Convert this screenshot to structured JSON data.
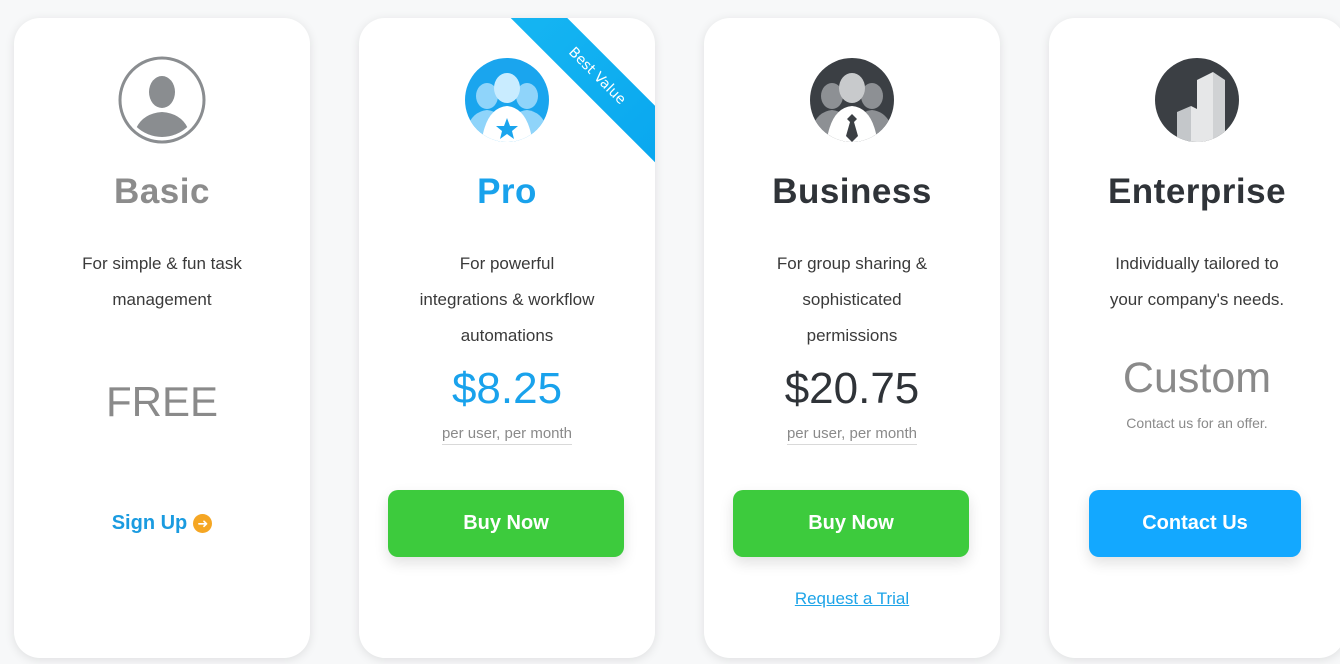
{
  "colors": {
    "basic_name": "#8c8c8c",
    "pro_accent": "#19a2ec",
    "business_name": "#2f3338",
    "enterprise_name": "#2f3338",
    "buy_green": "#3dcb3d",
    "contact_blue": "#13a8ff",
    "ribbon_blue": "#10aef0",
    "signup_arrow": "#f5a623"
  },
  "plans": {
    "basic": {
      "icon": "single-person-icon",
      "name": "Basic",
      "desc_line1": "For simple & fun task",
      "desc_line2": "management",
      "price": "FREE",
      "cta": "Sign Up",
      "cta_icon": "arrow-right-circle-icon"
    },
    "pro": {
      "icon": "team-star-icon",
      "ribbon": "Best Value",
      "name": "Pro",
      "desc_line1": "For powerful",
      "desc_line2": "integrations & workflow",
      "desc_line3": "automations",
      "price": "$8.25",
      "price_sub": "per user, per month",
      "cta": "Buy Now"
    },
    "business": {
      "icon": "team-tie-icon",
      "name": "Business",
      "desc_line1": "For group sharing &",
      "desc_line2": "sophisticated",
      "desc_line3": "permissions",
      "price": "$20.75",
      "price_sub": "per user, per month",
      "cta": "Buy Now",
      "secondary": "Request a Trial"
    },
    "enterprise": {
      "icon": "building-icon",
      "name": "Enterprise",
      "desc_line1": "Individually tailored to",
      "desc_line2": "your company's needs.",
      "price": "Custom",
      "price_sub": "Contact us for an offer.",
      "cta": "Contact Us"
    }
  }
}
